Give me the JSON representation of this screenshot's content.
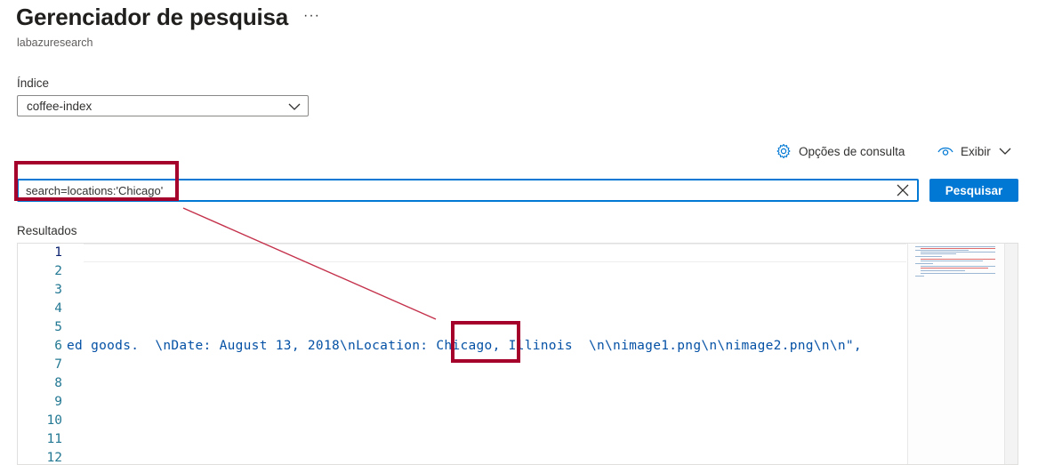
{
  "header": {
    "title": "Gerenciador de pesquisa",
    "more_label": "···",
    "subtitle": "labazuresearch"
  },
  "index": {
    "label": "Índice",
    "selected": "coffee-index"
  },
  "toolbar": {
    "query_options_label": "Opções de consulta",
    "view_label": "Exibir"
  },
  "search": {
    "value": "search=locations:'Chicago'",
    "button_label": "Pesquisar"
  },
  "results": {
    "label": "Resultados",
    "line_numbers": [
      "1",
      "2",
      "3",
      "4",
      "5",
      "6",
      "7",
      "8",
      "9",
      "10",
      "11",
      "12"
    ],
    "line6": {
      "before": "ed goods.  \\nDate: August 13, 2018\\nLocation: ",
      "highlight": "Chicago",
      "after": ", Illinois  \\n\\nimage1.png\\n\\nimage2.png\\n\\n\","
    }
  },
  "colors": {
    "accent": "#0078d4",
    "highlight_box": "#a4002b",
    "line_number": "#237893",
    "code_string": "#0451a5"
  }
}
